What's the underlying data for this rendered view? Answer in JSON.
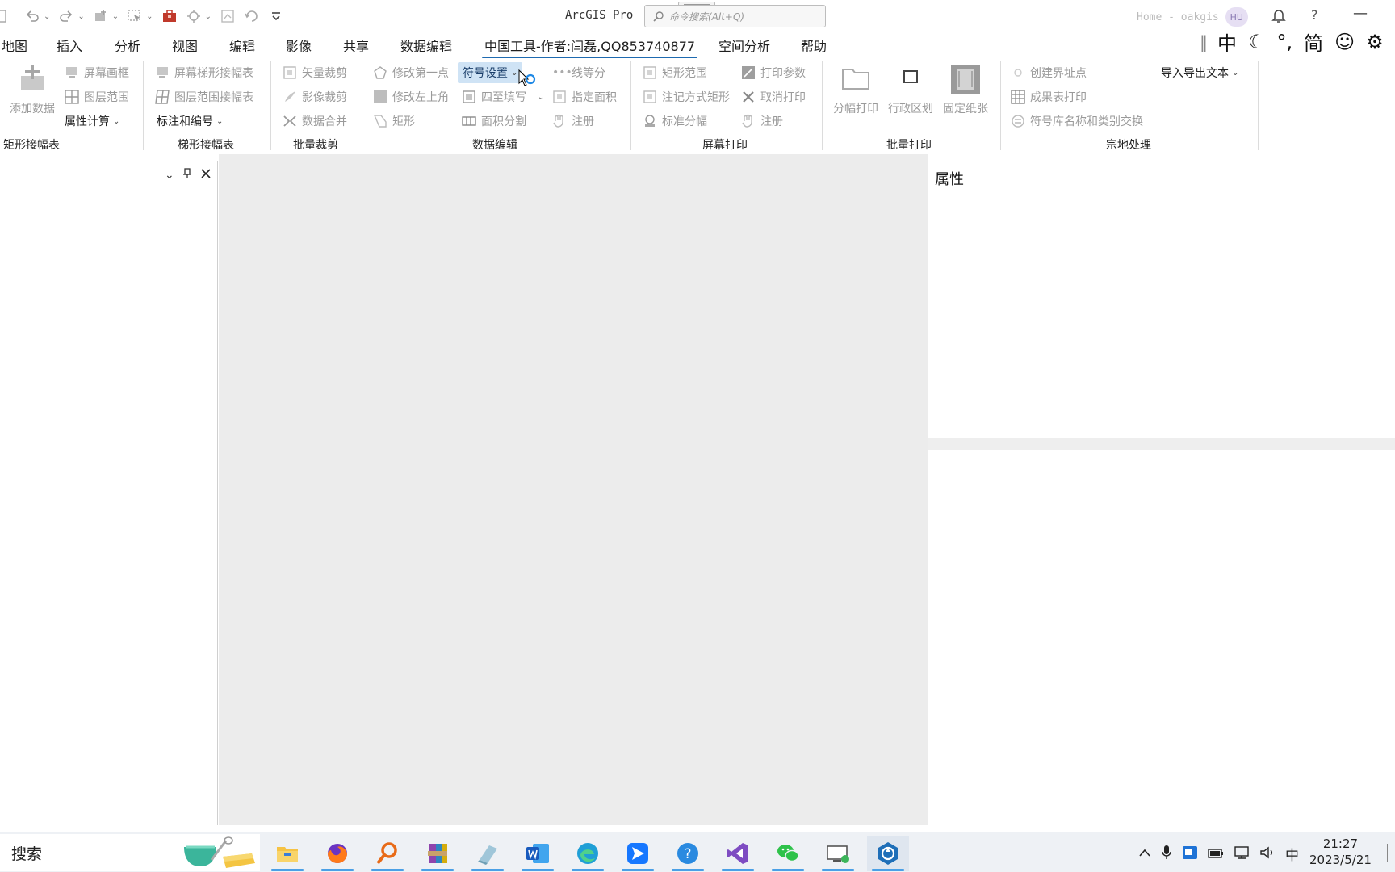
{
  "app": {
    "title": "ArcGIS Pro",
    "search_placeholder": "命令搜索(Alt+Q)",
    "user": "Home - oakgis",
    "avatar": "HU",
    "help": "?",
    "minimize": "—"
  },
  "tabs": [
    "地图",
    "插入",
    "分析",
    "视图",
    "编辑",
    "影像",
    "共享",
    "数据编辑",
    "中国工具-作者:闫磊,QQ853740877",
    "空间分析",
    "帮助"
  ],
  "active_tab": "中国工具-作者:闫磊,QQ853740877",
  "ime": [
    "中",
    "☾",
    "°,",
    "简",
    "☺",
    "⚙"
  ],
  "ribbon": {
    "rect_sheet": {
      "label": "矩形接幅表",
      "add_data": "添加数据",
      "screen_frame": "屏幕画框",
      "layer_extent": "图层范围",
      "attr_calc": "属性计算"
    },
    "trap_sheet": {
      "label": "梯形接幅表",
      "screen_trap": "屏幕梯形接幅表",
      "layer_trap": "图层范围接幅表",
      "annot_num": "标注和编号"
    },
    "batch_clip": {
      "label": "批量裁剪",
      "vector_clip": "矢量裁剪",
      "image_clip": "影像裁剪",
      "data_merge": "数据合并"
    },
    "data_edit": {
      "label": "数据编辑",
      "modify_first": "修改第一点",
      "symbol_settings": "符号设置",
      "line_divide": "线等分",
      "modify_ul": "修改左上角",
      "four_fill": "四至填写",
      "assign_area": "指定面积",
      "rect": "矩形",
      "area_split": "面积分割",
      "register": "注册"
    },
    "screen_print": {
      "label": "屏幕打印",
      "rect_extent": "矩形范围",
      "print_params": "打印参数",
      "annot_rect": "注记方式矩形",
      "cancel_print": "取消打印",
      "std_sheet": "标准分幅",
      "register": "注册"
    },
    "batch_print": {
      "label": "批量打印",
      "sheet_print": "分幅打印",
      "admin_zone": "行政区划",
      "fixed_paper": "固定纸张"
    },
    "parcel": {
      "label": "宗地处理",
      "create_points": "创建界址点",
      "result_print": "成果表打印",
      "import_export": "导入导出文本",
      "symbol_swap": "符号库名称和类别交换"
    }
  },
  "properties_title": "属性",
  "taskbar": {
    "search": "搜索",
    "tray_lang": "中",
    "time": "21:27",
    "date": "2023/5/21"
  }
}
